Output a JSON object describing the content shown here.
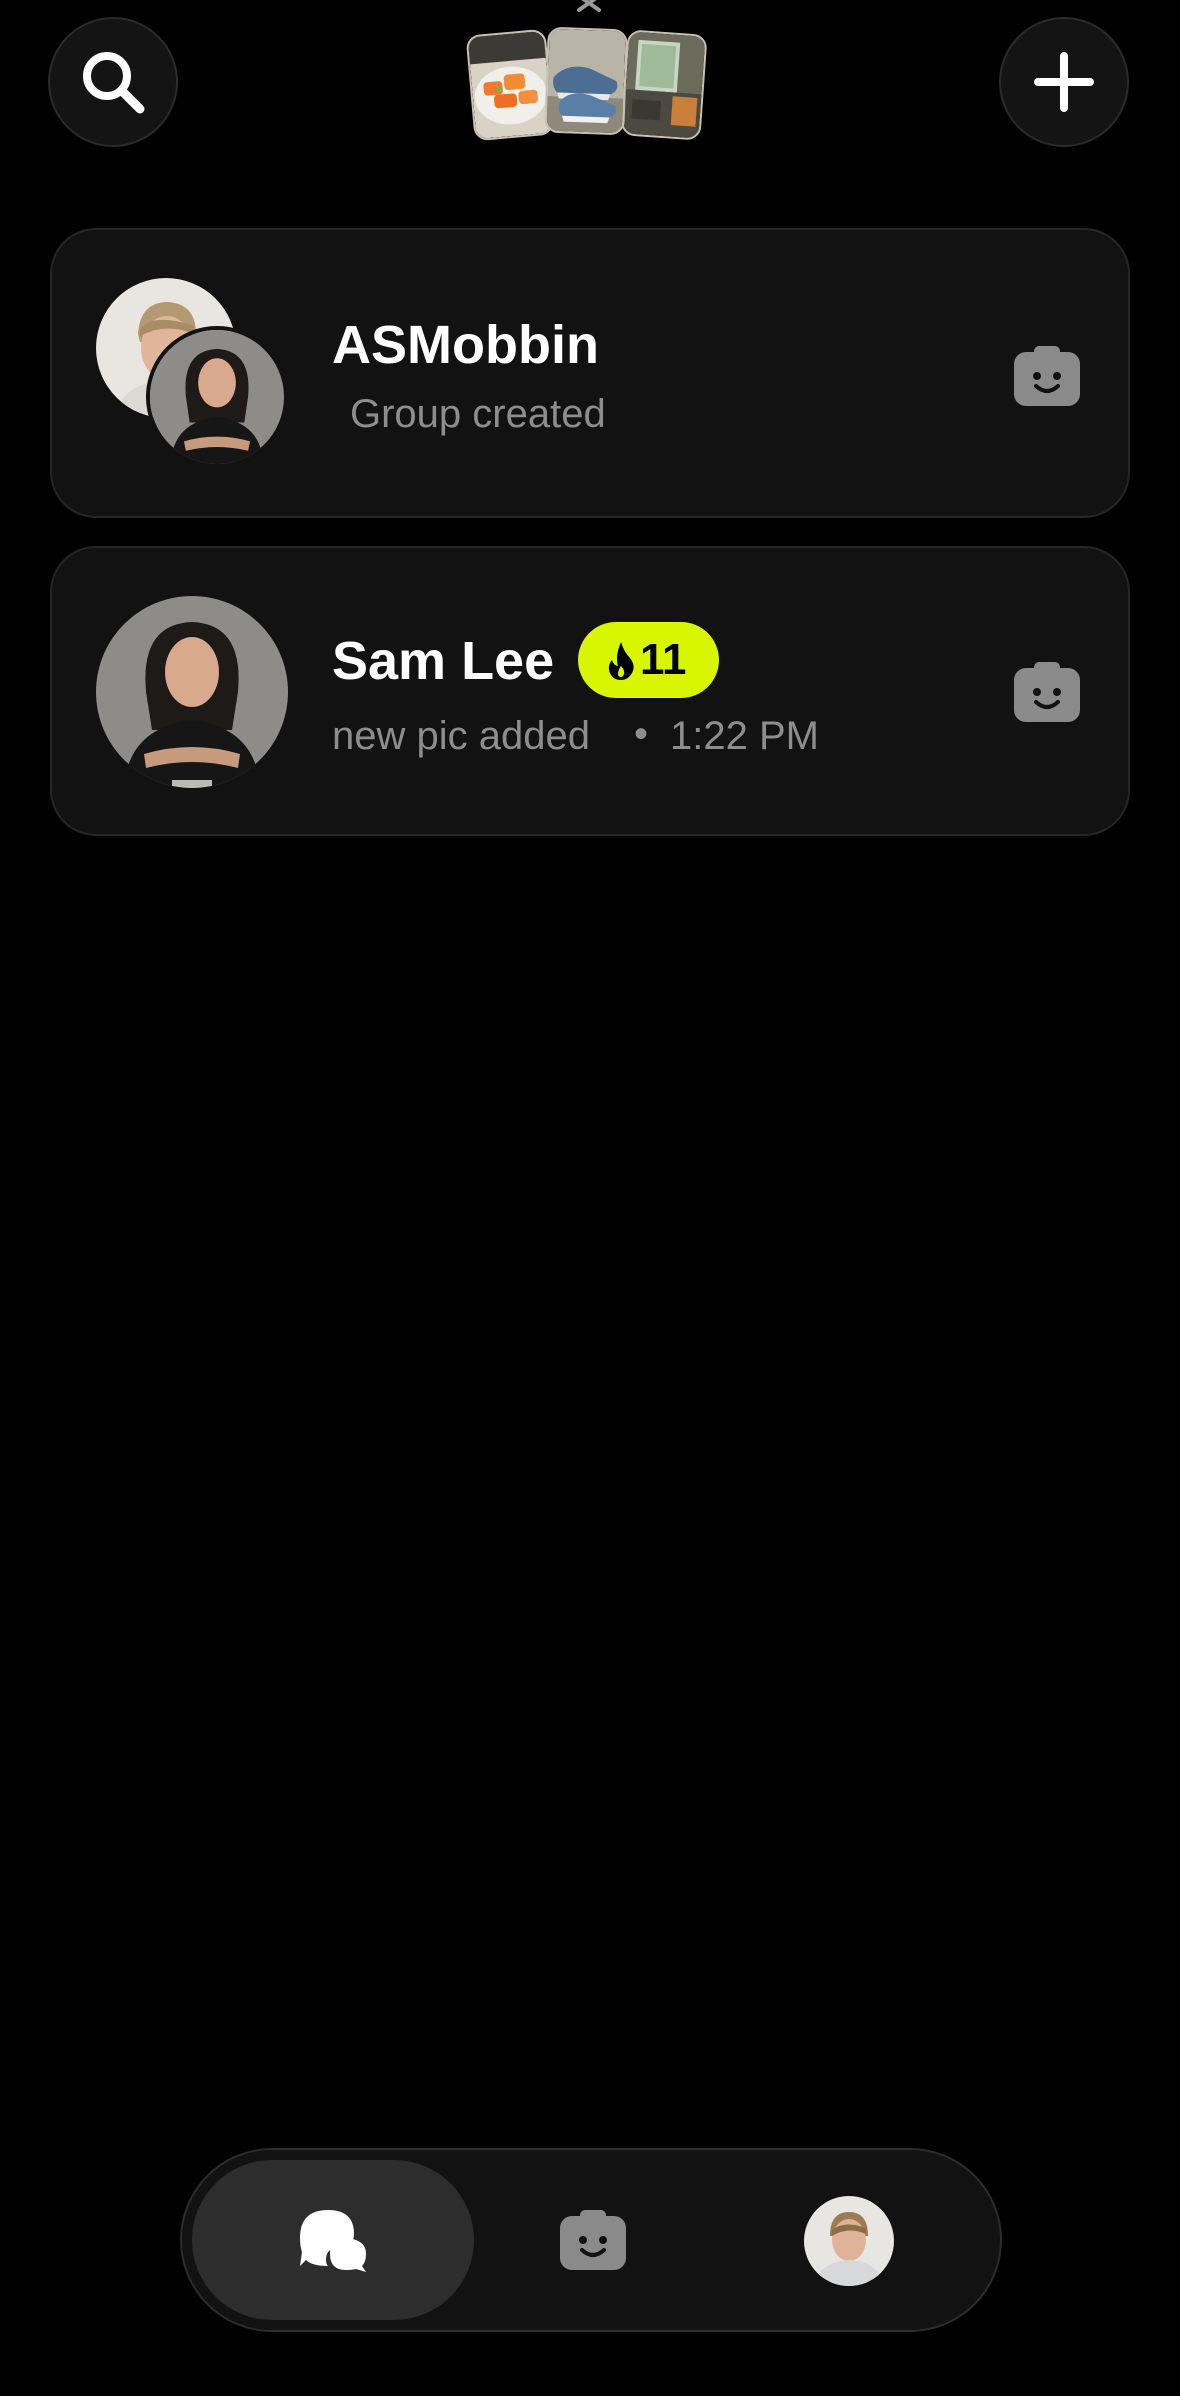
{
  "header": {
    "search_icon": "search-icon",
    "add_icon": "plus-icon",
    "dismiss_icon": "close-icon",
    "recent_photos": [
      "food-photo",
      "sneakers-photo",
      "room-photo"
    ]
  },
  "chats": [
    {
      "title": "ASMobbin",
      "subtitle": "Group created",
      "avatars": [
        "man-avatar",
        "woman-avatar"
      ],
      "action_icon": "camera-icon"
    },
    {
      "title": "Sam Lee",
      "streak": "11",
      "streak_icon": "flame-icon",
      "subtitle": "new pic added",
      "separator": "•",
      "time": "1:22 PM",
      "avatars": [
        "woman-avatar"
      ],
      "action_icon": "camera-icon"
    }
  ],
  "bottom_nav": {
    "items": [
      "chats-icon",
      "camera-icon",
      "profile-avatar"
    ],
    "active": "chats-icon"
  },
  "colors": {
    "background": "#000000",
    "card": "#121212",
    "accent": "#d7f600",
    "muted_text": "#8d8d8d",
    "icon_gray": "#8a8a8a"
  }
}
